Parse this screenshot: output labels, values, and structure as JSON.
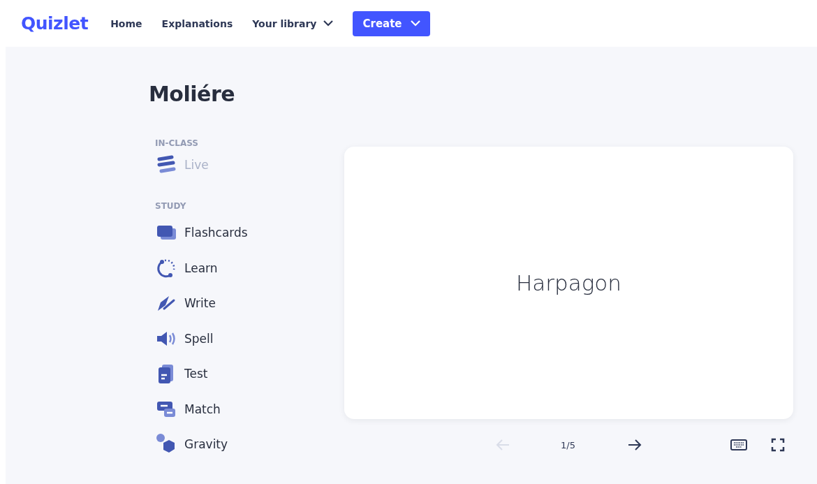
{
  "header": {
    "logo": "Quizlet",
    "nav": [
      {
        "label": "Home",
        "dropdown": false
      },
      {
        "label": "Explanations",
        "dropdown": false
      },
      {
        "label": "Your library",
        "dropdown": true
      }
    ],
    "create_button": "Create"
  },
  "set_title": "Moliére",
  "sections": [
    {
      "heading": "IN-CLASS",
      "items": [
        {
          "kind": "live",
          "label": "Live",
          "disabled": true
        }
      ]
    },
    {
      "heading": "STUDY",
      "items": [
        {
          "kind": "flashcards",
          "label": "Flashcards",
          "disabled": false
        },
        {
          "kind": "learn",
          "label": "Learn",
          "disabled": false
        },
        {
          "kind": "write",
          "label": "Write",
          "disabled": false
        },
        {
          "kind": "spell",
          "label": "Spell",
          "disabled": false
        },
        {
          "kind": "test",
          "label": "Test",
          "disabled": false
        },
        {
          "kind": "match",
          "label": "Match",
          "disabled": false
        },
        {
          "kind": "gravity",
          "label": "Gravity",
          "disabled": false
        }
      ]
    }
  ],
  "card": {
    "term": "Harpagon"
  },
  "controls": {
    "prev_disabled": true,
    "next_disabled": false,
    "counter": "1/5"
  }
}
